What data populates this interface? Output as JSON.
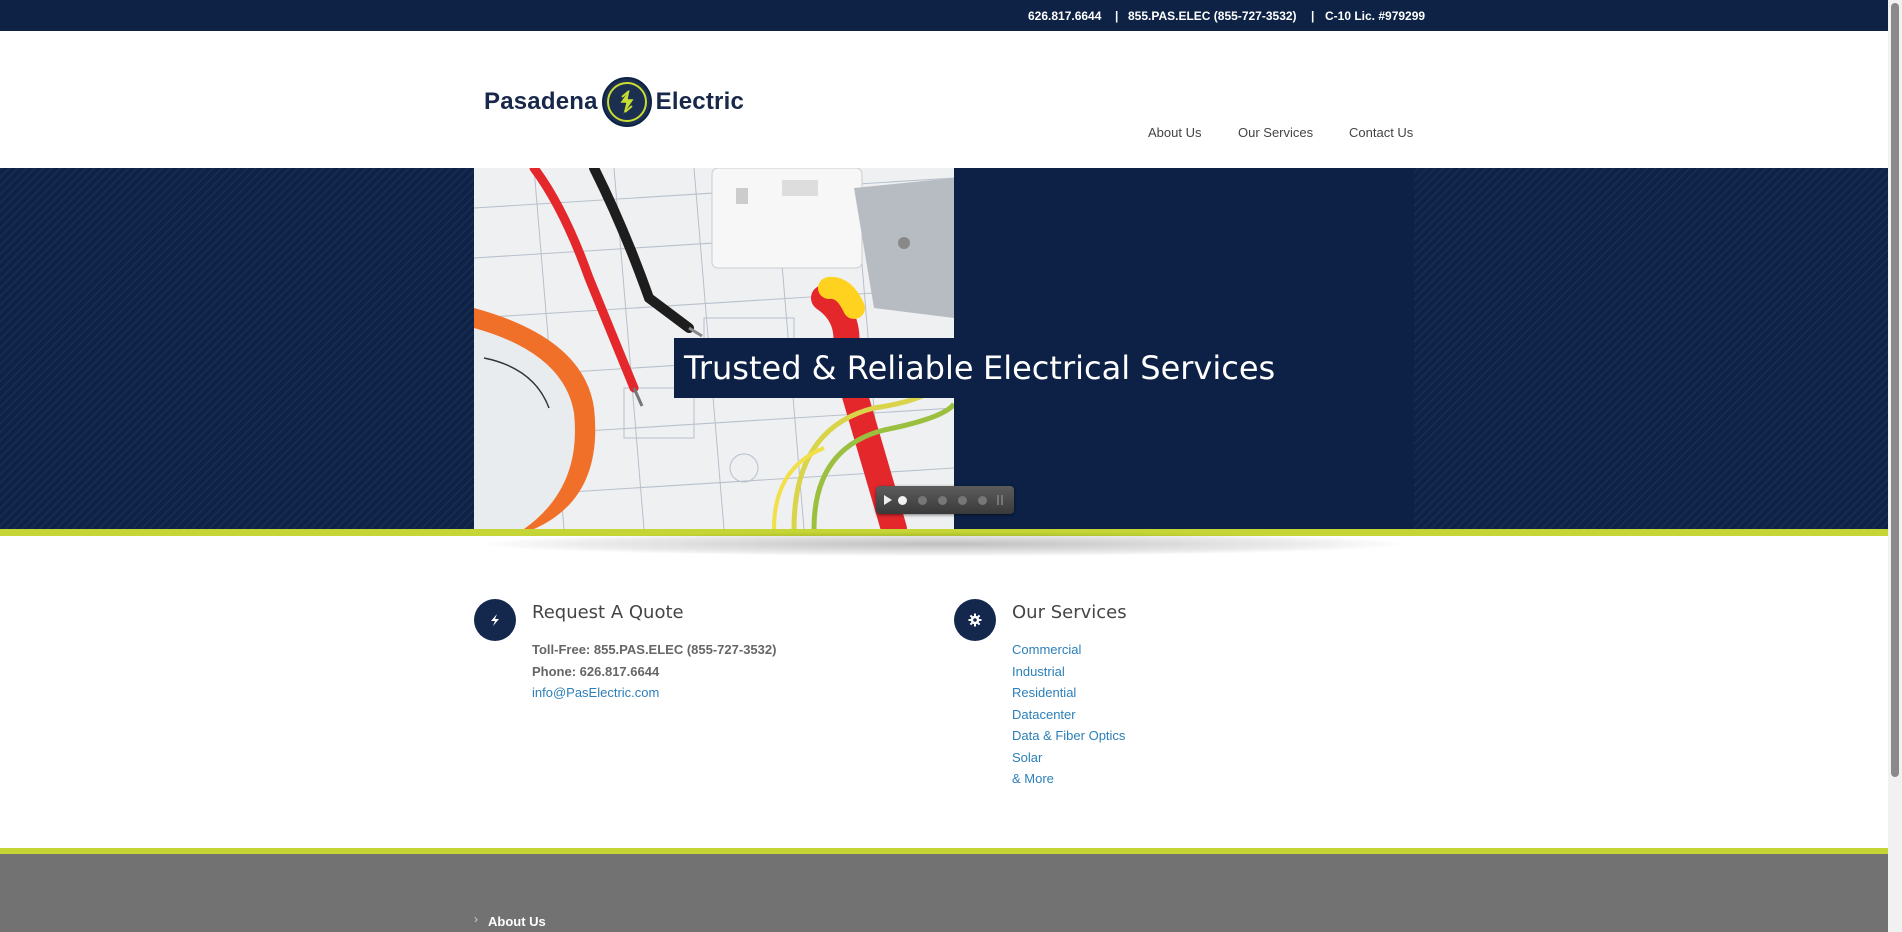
{
  "topbar": {
    "phone": "626.817.6644",
    "sep1": "|",
    "tollfree": "855.PAS.ELEC  (855-727-3532)",
    "sep2": "|",
    "license": "C-10 Lic. #979299"
  },
  "logo": {
    "left_word": "Pasadena",
    "right_word": "Electric",
    "icon": "lightning-bolt-icon"
  },
  "nav": [
    {
      "label": "About Us"
    },
    {
      "label": "Our Services"
    },
    {
      "label": "Contact Us"
    }
  ],
  "hero": {
    "title_part1": "Trusted & Reliable",
    "title_part2": "Electrical Services",
    "slides_count": 5,
    "active_slide": 1
  },
  "quote": {
    "icon": "lightning-icon",
    "title": "Request A Quote",
    "tollfree": "Toll-Free: 855.PAS.ELEC (855-727-3532)",
    "phone": "Phone: 626.817.6644",
    "email": "info@PasElectric.com"
  },
  "services": {
    "icon": "gear-icon",
    "title": "Our Services",
    "items": [
      "Commercial",
      "Industrial",
      "Residential",
      "Datacenter",
      "Data & Fiber Optics",
      "Solar",
      "& More"
    ]
  },
  "footer": {
    "link": "About Us"
  },
  "colors": {
    "navy": "#0d2244",
    "accent": "#c4d535",
    "link": "#2c7fb8",
    "footer": "#727272"
  }
}
